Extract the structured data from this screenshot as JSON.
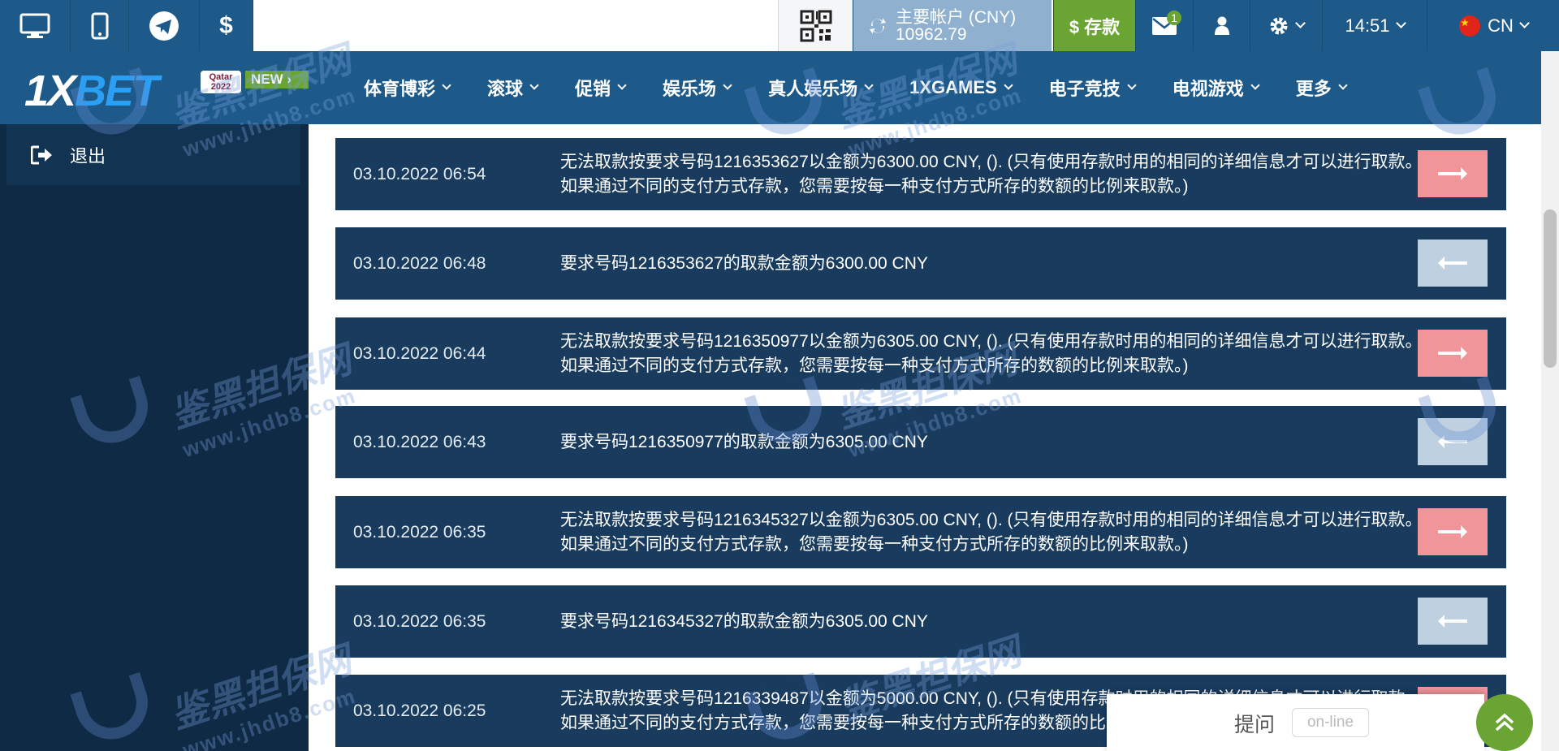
{
  "account": {
    "label": "主要帐户 (CNY)",
    "balance": "10962.79"
  },
  "deposit_label": "$ 存款",
  "mail_count": "1",
  "time": "14:51",
  "language": "CN",
  "logo": {
    "x": "1X",
    "bet": "BET",
    "qatar": "Qatar 2022",
    "new": "NEW ›"
  },
  "nav": [
    {
      "label": "体育博彩"
    },
    {
      "label": "滚球"
    },
    {
      "label": "促销"
    },
    {
      "label": "娱乐场"
    },
    {
      "label": "真人娱乐场"
    },
    {
      "label": "1XGAMES"
    },
    {
      "label": "电子竞技"
    },
    {
      "label": "电视游戏"
    },
    {
      "label": "更多"
    }
  ],
  "sidebar": {
    "logout_label": "退出"
  },
  "transactions": [
    {
      "date": "03.10.2022 06:54",
      "message": "无法取款按要求号码1216353627以金额为6300.00 CNY, (). (只有使用存款时用的相同的详细信息才可以进行取款。如果通过不同的支付方式存款，您需要按每一种支付方式所存的数额的比例来取款。)",
      "direction": "out"
    },
    {
      "date": "03.10.2022 06:48",
      "message": "要求号码1216353627的取款金额为6300.00 CNY",
      "direction": "in"
    },
    {
      "date": "03.10.2022 06:44",
      "message": "无法取款按要求号码1216350977以金额为6305.00 CNY, (). (只有使用存款时用的相同的详细信息才可以进行取款。如果通过不同的支付方式存款，您需要按每一种支付方式所存的数额的比例来取款。)",
      "direction": "out"
    },
    {
      "date": "03.10.2022 06:43",
      "message": "要求号码1216350977的取款金额为6305.00 CNY",
      "direction": "in"
    },
    {
      "date": "03.10.2022 06:35",
      "message": "无法取款按要求号码1216345327以金额为6305.00 CNY, (). (只有使用存款时用的相同的详细信息才可以进行取款。如果通过不同的支付方式存款，您需要按每一种支付方式所存的数额的比例来取款。)",
      "direction": "out"
    },
    {
      "date": "03.10.2022 06:35",
      "message": "要求号码1216345327的取款金额为6305.00 CNY",
      "direction": "in"
    },
    {
      "date": "03.10.2022 06:25",
      "message": "无法取款按要求号码1216339487以金额为5000.00 CNY, (). (只有使用存款时用的相同的详细信息才可以进行取款。如果通过不同的支付方式存款，您需要按每一种支付方式所存的数额的比例来取款。)",
      "direction": "out"
    }
  ],
  "chat": {
    "label": "提问",
    "status": "on-line"
  },
  "watermark": {
    "brand": "鉴黑担保网",
    "url": "www.jhdb8.com"
  },
  "colors": {
    "primary": "#1d5a8a",
    "deposit_green": "#6aa433",
    "row_bg": "#193b5e",
    "arrow_out": "#f0969b",
    "arrow_in": "#bfd1e1"
  }
}
